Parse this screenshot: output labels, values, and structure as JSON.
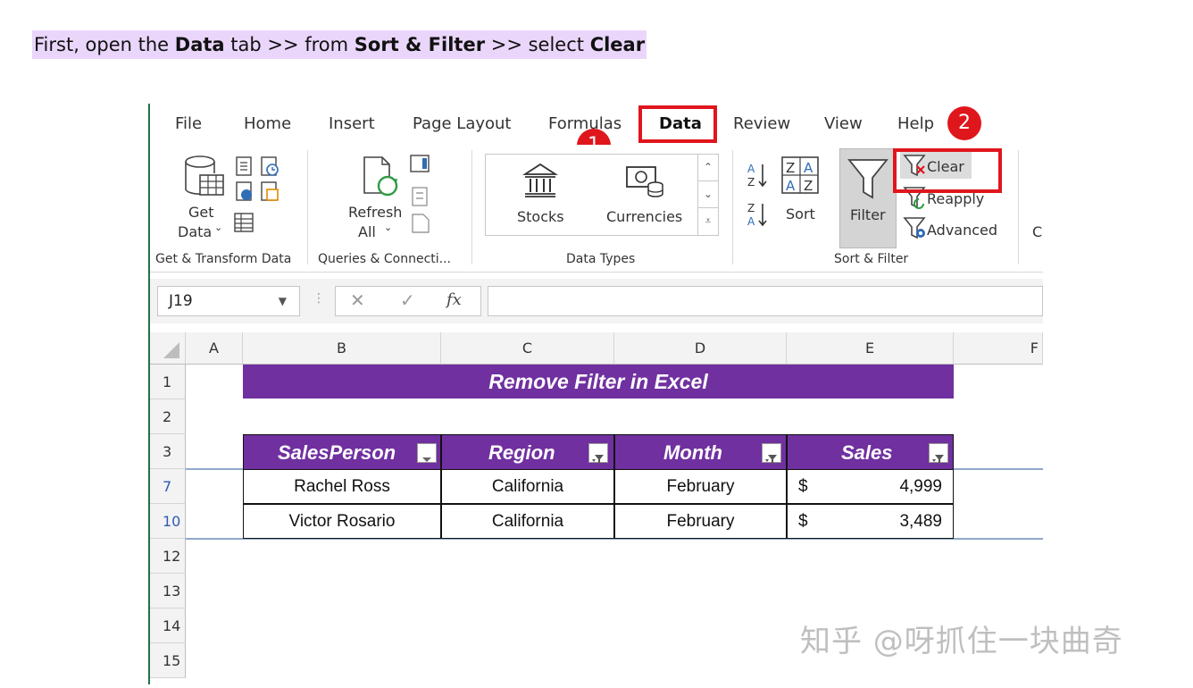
{
  "caption": {
    "p1": "First, open the ",
    "b1": "Data",
    "p2": " tab >> from ",
    "b2": "Sort & Filter",
    "p3": " >> select ",
    "b3": "Clear"
  },
  "tabs": [
    "File",
    "Home",
    "Insert",
    "Page Layout",
    "Formulas",
    "Data",
    "Review",
    "View",
    "Help"
  ],
  "active_tab": "Data",
  "badges": [
    "1",
    "2"
  ],
  "ribbon": {
    "get_data_line1": "Get",
    "get_data_line2": "Data",
    "refresh_line1": "Refresh",
    "refresh_line2": "All",
    "stocks": "Stocks",
    "currencies": "Currencies",
    "sort": "Sort",
    "filter": "Filter",
    "clear": "Clear",
    "reapply": "Reapply",
    "advanced": "Advanced",
    "partial_next": "C",
    "groups": {
      "get_transform": "Get & Transform Data",
      "queries": "Queries & Connecti...",
      "data_types": "Data Types",
      "sort_filter": "Sort & Filter"
    }
  },
  "formula_bar": {
    "cell_ref": "J19",
    "fx": "fx",
    "cancel": "✕",
    "enter": "✓",
    "value": ""
  },
  "sheet": {
    "columns": [
      "A",
      "B",
      "C",
      "D",
      "E",
      "F"
    ],
    "rows": [
      "1",
      "2",
      "3",
      "7",
      "10",
      "12",
      "13",
      "14",
      "15"
    ],
    "title": "Remove Filter in Excel",
    "headers": [
      "SalesPerson",
      "Region",
      "Month",
      "Sales"
    ],
    "data_rows": [
      {
        "person": "Rachel Ross",
        "region": "California",
        "month": "February",
        "currency": "$",
        "sales": "4,999"
      },
      {
        "person": "Victor Rosario",
        "region": "California",
        "month": "February",
        "currency": "$",
        "sales": "3,489"
      }
    ]
  },
  "watermark": "知乎 @呀抓住一块曲奇",
  "colors": {
    "accent": "#7030a0",
    "highlight": "#e0161d",
    "caption_bg": "#ead6fb",
    "excel_green": "#217346"
  }
}
